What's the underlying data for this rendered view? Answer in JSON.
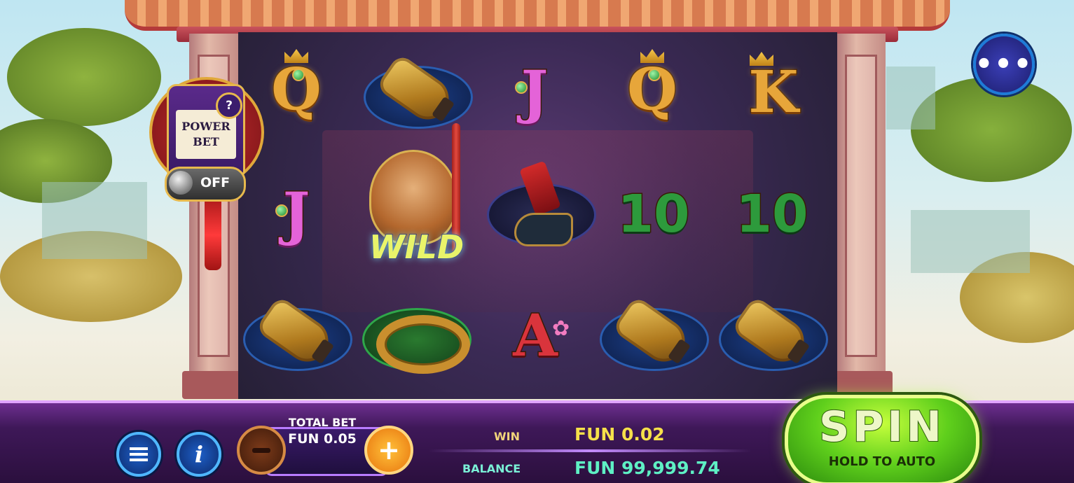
{
  "power_bet": {
    "line1": "POWER",
    "line2": "BET",
    "help_icon": "?",
    "toggle_state": "OFF"
  },
  "reels": {
    "symbols": [
      [
        "Q",
        "gauntlet",
        "J",
        "Q",
        "K"
      ],
      [
        "J",
        "WILD",
        "boot",
        "10",
        "10"
      ],
      [
        "gauntlet",
        "ring",
        "A",
        "gauntlet",
        "gauntlet"
      ]
    ],
    "wild_label": "WILD",
    "letters": {
      "q1": "Q",
      "j1": "J",
      "q2": "Q",
      "k1": "K",
      "j2": "J",
      "ten1": "10",
      "ten2": "10",
      "a1": "A"
    }
  },
  "menu_button_icon": "more-dots-icon",
  "menu_button_text": "•••",
  "bottom_bar": {
    "total_bet_label": "TOTAL BET",
    "total_bet_value": "FUN 0.05",
    "plus_text": "+",
    "win_label": "WIN",
    "win_value": "FUN 0.02",
    "balance_label": "BALANCE",
    "balance_value": "FUN 99,999.74",
    "info_text": "i"
  },
  "spin": {
    "label": "SPIN",
    "sublabel": "HOLD TO AUTO"
  },
  "colors": {
    "bar_purple": "#3e1858",
    "spin_green": "#5fcf1c",
    "win_yellow": "#f6e04a",
    "balance_cyan": "#5ef0c4"
  }
}
